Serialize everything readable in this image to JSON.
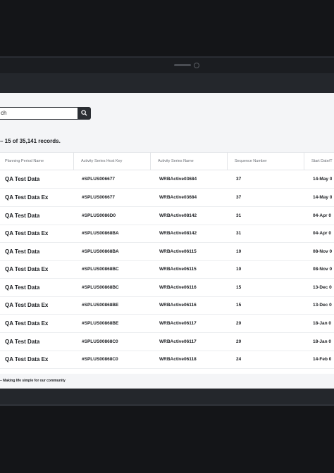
{
  "search": {
    "value": "ch"
  },
  "records_text": "– 15 of 35,141 records.",
  "columns": [
    "Planning Period Name",
    "Activity Series Host Key",
    "Activity Series Name",
    "Sequence Number",
    "Start Date/T"
  ],
  "rows": [
    [
      "QA Test Data",
      "#SPLUS006677",
      "WRBActive03684",
      "37",
      "14-May 0"
    ],
    [
      "QA Test Data Ex",
      "#SPLUS006677",
      "WRBActive03684",
      "37",
      "14-May 0"
    ],
    [
      "QA Test Data",
      "#SPLUS0086D0",
      "WRBActive08142",
      "31",
      "04-Apr 0"
    ],
    [
      "QA Test Data Ex",
      "#SPLUS00868BA",
      "WRBActive08142",
      "31",
      "04-Apr 0"
    ],
    [
      "QA Test Data",
      "#SPLUS00868BA",
      "WRBActive06115",
      "10",
      "08-Nov 0"
    ],
    [
      "QA Test Data Ex",
      "#SPLUS00868BC",
      "WRBActive06115",
      "10",
      "08-Nov 0"
    ],
    [
      "QA Test Data",
      "#SPLUS00868BC",
      "WRBActive06116",
      "15",
      "13-Dec 0"
    ],
    [
      "QA Test Data Ex",
      "#SPLUS00868BE",
      "WRBActive06116",
      "15",
      "13-Dec 0"
    ],
    [
      "QA Test Data Ex",
      "#SPLUS00868BE",
      "WRBActive06117",
      "20",
      "18-Jan 0"
    ],
    [
      "QA Test Data",
      "#SPLUS00868C0",
      "WRBActive06117",
      "20",
      "18-Jan 0"
    ],
    [
      "QA Test Data Ex",
      "#SPLUS00868C0",
      "WRBActive06118",
      "24",
      "14-Feb 0"
    ]
  ],
  "footer": {
    "tagline": "–  Making life simple for our community"
  }
}
